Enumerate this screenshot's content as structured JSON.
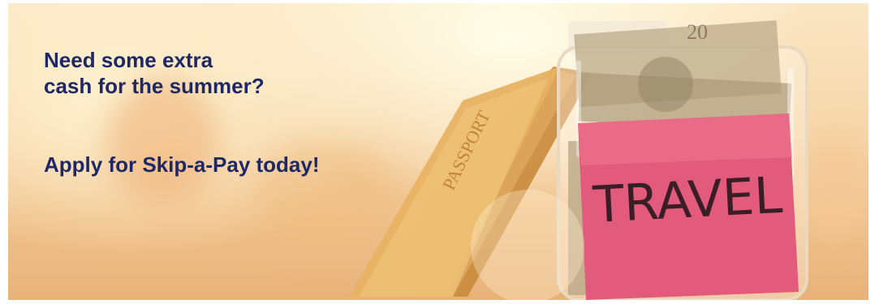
{
  "banner": {
    "headline_line1": "Need some extra",
    "headline_line2": "cash for the summer?",
    "cta": "Apply for Skip-a-Pay today!",
    "passport_text": "PASSPORT",
    "bill_denomination": "20",
    "jar_label_text": "TRAVEL",
    "colors": {
      "text": "#1f2866",
      "label": "#e05a7a",
      "warm_background": "#f6d5a8"
    }
  }
}
